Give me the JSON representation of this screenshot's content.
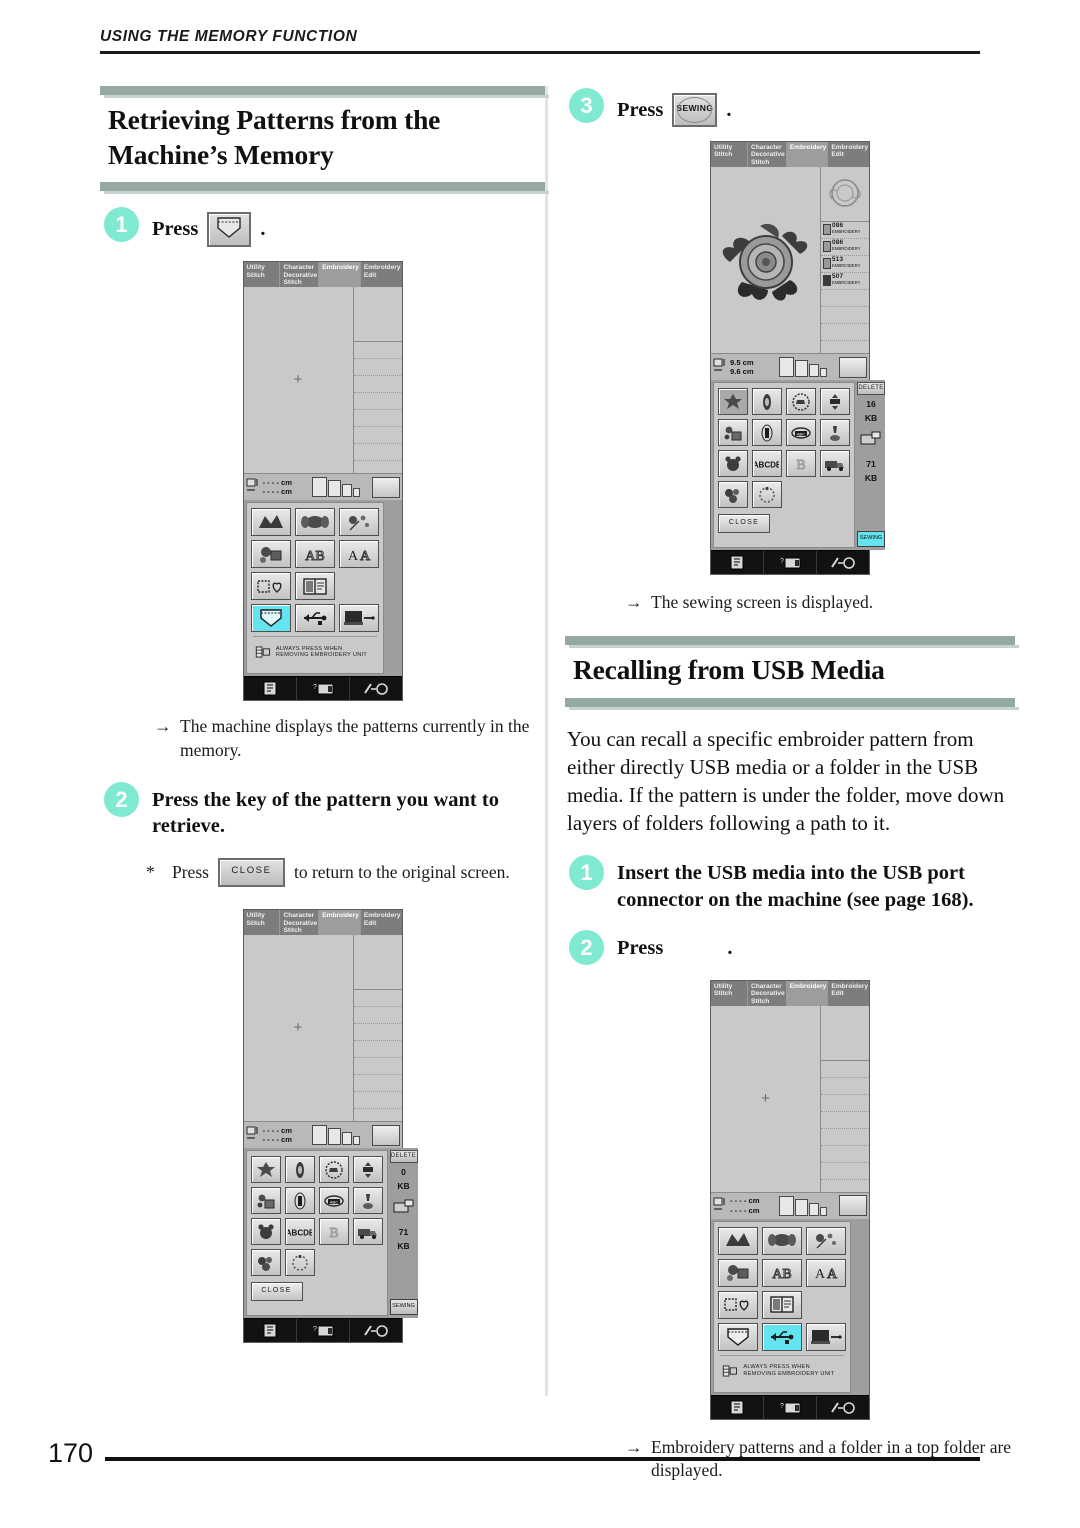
{
  "header": {
    "running_head": "USING THE MEMORY FUNCTION"
  },
  "page": {
    "number": "170"
  },
  "left_column": {
    "section": {
      "title_line1": "Retrieving Patterns from the",
      "title_line2": "Machine’s Memory"
    },
    "step1": {
      "number": "1",
      "label": "Press",
      "key_icon": "pocket-memory-icon",
      "period": "."
    },
    "note1": {
      "arrow": "→",
      "text": "The machine displays the patterns currently in the memory."
    },
    "step2": {
      "number": "2",
      "text": "Press the key of the pattern you want to retrieve."
    },
    "starnote": {
      "star": "*",
      "before": "Press",
      "key_label": "CLOSE",
      "after": "to return to the original screen."
    }
  },
  "right_column": {
    "step3": {
      "number": "3",
      "label": "Press",
      "key_label": "SEWING",
      "period": "."
    },
    "note3": {
      "arrow": "→",
      "text": "The sewing screen is displayed."
    },
    "section": {
      "title": "Recalling from USB Media"
    },
    "paragraph": "You can recall a specific embroider pattern from either directly USB media or a folder in the USB media. If the pattern is under the folder, move down layers of folders following a path to it.",
    "step1": {
      "number": "1",
      "text": "Insert the USB media into the USB port connector on the machine (see page 168)."
    },
    "step2": {
      "number": "2",
      "label": "Press",
      "period": "."
    },
    "note_bottom": {
      "arrow": "→",
      "text": "Embroidery patterns and a folder in a top folder are displayed."
    }
  },
  "lcd": {
    "tabs": [
      {
        "line1": "Utility",
        "line2": "Stitch",
        "line3": ""
      },
      {
        "line1": "Character",
        "line2": "Decorative",
        "line3": "Stitch"
      },
      {
        "line1": "Embroidery",
        "line2": "",
        "line3": ""
      },
      {
        "line1": "Embroidery",
        "line2": "Edit",
        "line3": ""
      }
    ],
    "selected_tab": "Embroidery",
    "measurements_blank": {
      "w": "- - - - cm",
      "h": "- - - - cm"
    },
    "measurements_rose": {
      "w": "9.5 cm",
      "h": "9.6 cm"
    },
    "category_buttons": [
      [
        "embroidery-pattern-icon",
        "floral-pattern-icon",
        "floral-sprig-icon"
      ],
      [
        "character-pattern-icon",
        "frame-letters-AB-icon",
        "font-letters-AA-icon"
      ],
      [
        "frame-shapes-icon",
        "bookmark-patterns-icon"
      ],
      [
        "pocket-memory-icon",
        "usb-media-icon",
        "computer-link-icon"
      ]
    ],
    "always_press_text": "ALWAYS PRESS WHEN REMOVING EMBROIDERY UNIT",
    "memory_grid_icons": [
      [
        "star-flower-icon",
        "ornament-icon",
        "circle-cart-icon",
        "lantern-icon"
      ],
      [
        "sewing-kit-icon",
        "thimble-icon",
        "abcd-oval-icon",
        "lamp-icon"
      ],
      [
        "bear-icon",
        "ABCDE-text-icon",
        "letter-B-icon",
        "truck-icon"
      ],
      [
        "cluster-icon",
        "ring-icon"
      ]
    ],
    "close_label": "CLOSE",
    "delete_label": "DELETE",
    "sewing_label": "SEWING",
    "memory_used_empty": "0",
    "memory_used_rose": "16",
    "memory_unit": "KB",
    "memory_free": "71",
    "thread_list": [
      {
        "code": "086",
        "name": "EMBROIDERY"
      },
      {
        "code": "086",
        "name": "EMBROIDERY"
      },
      {
        "code": "513",
        "name": "EMBROIDERY"
      },
      {
        "code": "507",
        "name": "EMBROIDERY"
      }
    ]
  },
  "colors": {
    "accent_teal": "#7fe9d1",
    "heading_bar": "#93a9a2",
    "lcd_highlight": "#63e4ef",
    "text": "#111111"
  }
}
